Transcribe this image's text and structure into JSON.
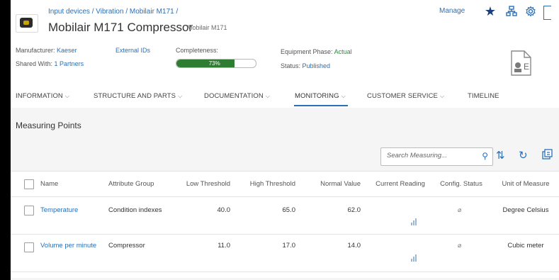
{
  "header": {
    "breadcrumb": "Input devices / Vibration / Mobilair M171 /",
    "title": "Mobilair M171 Compressor",
    "subtitle": "Mobilair M171",
    "manage_label": "Manage"
  },
  "meta": {
    "manufacturer_label": "Manufacturer:",
    "manufacturer_value": "Kaeser",
    "external_ids_label": "External IDs",
    "shared_label": "Shared With:",
    "shared_value": "1 Partners",
    "completeness_label": "Completeness:",
    "completeness_text": "73%",
    "completeness_value": 73,
    "phase_label": "Equipment Phase:",
    "phase_value": "Actual",
    "status_label": "Status:",
    "status_value": "Published"
  },
  "tabs": [
    {
      "label": "INFORMATION",
      "has_chevron": true,
      "active": false
    },
    {
      "label": "STRUCTURE AND PARTS",
      "has_chevron": true,
      "active": false
    },
    {
      "label": "DOCUMENTATION",
      "has_chevron": true,
      "active": false
    },
    {
      "label": "MONITORING",
      "has_chevron": true,
      "active": true
    },
    {
      "label": "CUSTOMER SERVICE",
      "has_chevron": true,
      "active": false
    },
    {
      "label": "TIMELINE",
      "has_chevron": false,
      "active": false
    }
  ],
  "measuring": {
    "section_title": "Measuring Points",
    "search_placeholder": "Search Measuring...",
    "columns": [
      "Name",
      "Attribute Group",
      "Low Threshold",
      "High Threshold",
      "Normal Value",
      "Current Reading",
      "Config. Status",
      "Unit of Measure"
    ],
    "rows": [
      {
        "name": "Temperature",
        "attribute_group": "Condition indexes",
        "low": "40.0",
        "high": "65.0",
        "normal": "62.0",
        "unit": "Degree Celsius"
      },
      {
        "name": "Volume per minute",
        "attribute_group": "Compressor",
        "low": "11.0",
        "high": "17.0",
        "normal": "14.0",
        "unit": "Cubic meter"
      }
    ]
  },
  "icons": {
    "favorite": "star-icon",
    "hierarchy": "hierarchy-icon",
    "settings": "gear-icon",
    "search": "search-icon",
    "sort": "sort-icon",
    "refresh": "refresh-icon",
    "export": "export-icon",
    "reading": "chart-icon",
    "config": "config-status-icon"
  },
  "colors": {
    "accent": "#2a6fb8",
    "progress": "#2f7d32",
    "phase": "#2b8a3e",
    "page_bg": "#f5f5f5"
  }
}
